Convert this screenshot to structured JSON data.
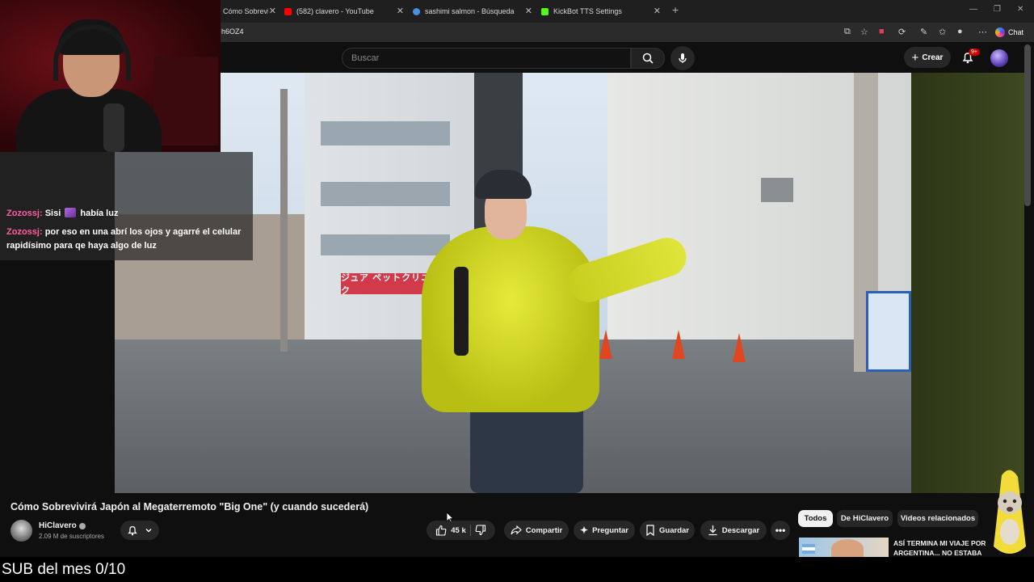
{
  "browser": {
    "tabs": [
      {
        "label": "Cómo Sobrevivirá Japón al M",
        "favicon_color": "#ff0000"
      },
      {
        "label": "(582) clavero - YouTube",
        "favicon_color": "#ff0000"
      },
      {
        "label": "sashimi salmon - Búsqueda",
        "favicon_color": "#4a90e2"
      },
      {
        "label": "KickBot TTS Settings",
        "favicon_color": "#53fc18"
      }
    ],
    "new_tab": "+",
    "url": "h6OZ4",
    "chat_label": "Chat"
  },
  "youtube": {
    "search_placeholder": "Buscar",
    "create_label": "Crear",
    "notifications_badge": "9+"
  },
  "stream_overlay": {
    "chat": [
      {
        "user": "Zozossj",
        "message_before_emote": "Sisi",
        "message_after_emote": "había luz"
      },
      {
        "user": "Zozossj",
        "message": "por eso en una abrí los ojos y agarré el celular rapidísimo para qe haya algo de luz"
      }
    ],
    "subgoal_text": "SUB del mes 0/10"
  },
  "video": {
    "title": "Cómo Sobrevivirá Japón al Megaterremoto \"Big One\" (y cuando sucederá)",
    "sign_text": "ジュア ペットクリニック",
    "channel": {
      "name": "HiClavero",
      "subscribers": "2.09 M de suscriptores"
    },
    "actions": {
      "likes": "45 k",
      "share": "Compartir",
      "ask": "Preguntar",
      "save": "Guardar",
      "download": "Descargar"
    }
  },
  "recommendations": {
    "chips": [
      {
        "label": "Todos",
        "active": true
      },
      {
        "label": "De HiClavero",
        "active": false
      },
      {
        "label": "Videos relacionados",
        "active": false
      }
    ],
    "first_title": "ASÍ TERMINA MI VIAJE POR ARGENTINA... NO ESTABA"
  }
}
